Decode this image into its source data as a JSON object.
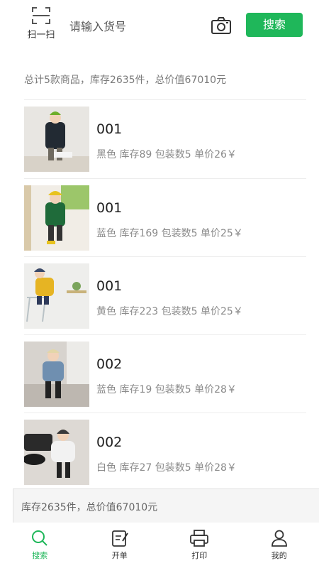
{
  "header": {
    "scan_label": "扫一扫",
    "search_placeholder": "请输入货号",
    "search_button": "搜索"
  },
  "summary": "总计5款商品，库存2635件，总价值67010元",
  "products": [
    {
      "code": "001",
      "meta": "黑色 库存89 包装数5 单价26￥",
      "accent": "#222a33"
    },
    {
      "code": "001",
      "meta": "蓝色 库存169 包装数5 单价25￥",
      "accent": "#1f6b3a"
    },
    {
      "code": "001",
      "meta": "黄色 库存223 包装数5 单价25￥",
      "accent": "#e6b423"
    },
    {
      "code": "002",
      "meta": "蓝色 库存19 包装数5 单价28￥",
      "accent": "#6f8fb0"
    },
    {
      "code": "002",
      "meta": "白色 库存27 包装数5 单价28￥",
      "accent": "#f2f2f2"
    }
  ],
  "footer_summary": "库存2635件，总价值67010元",
  "nav": {
    "items": [
      {
        "label": "搜索",
        "icon": "search-icon",
        "active": true
      },
      {
        "label": "开单",
        "icon": "edit-order-icon",
        "active": false
      },
      {
        "label": "打印",
        "icon": "printer-icon",
        "active": false
      },
      {
        "label": "我的",
        "icon": "user-icon",
        "active": false
      }
    ]
  },
  "colors": {
    "accent": "#1fb75a",
    "text_muted": "#8a8a8a"
  }
}
